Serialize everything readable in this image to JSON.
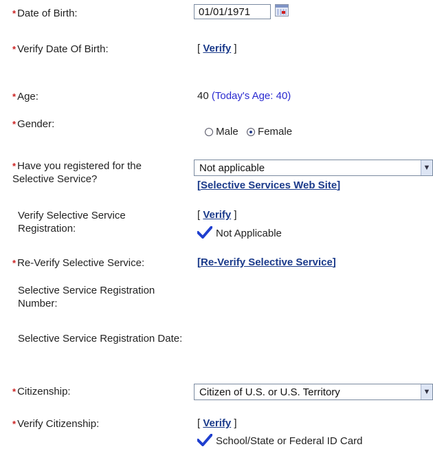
{
  "fields": {
    "dob": {
      "label": "Date of Birth:",
      "value": "01/01/1971"
    },
    "verify_dob": {
      "label": "Verify Date Of Birth:",
      "link": "Verify"
    },
    "age": {
      "label": "Age:",
      "value": "40",
      "todays": "(Today's Age: 40)"
    },
    "gender": {
      "label": "Gender:",
      "option_male": "Male",
      "option_female": "Female",
      "selected": "Female"
    },
    "selective_service": {
      "label": "Have you registered for the Selective Service?",
      "selected": "Not applicable",
      "link": "Selective Services Web Site"
    },
    "verify_selective": {
      "label": "Verify Selective Service Registration:",
      "link": "Verify",
      "status": "Not Applicable"
    },
    "reverify_selective": {
      "label": "Re-Verify Selective Service:",
      "link": "Re-Verify Selective Service"
    },
    "ss_reg_number": {
      "label": "Selective Service Registration Number:"
    },
    "ss_reg_date": {
      "label": "Selective Service Registration Date:"
    },
    "citizenship": {
      "label": "Citizenship:",
      "selected": "Citizen of U.S. or U.S. Territory"
    },
    "verify_citizenship": {
      "label": "Verify Citizenship:",
      "link": "Verify",
      "status": "School/State or Federal ID Card"
    }
  },
  "required_marker": "*",
  "colors": {
    "link": "#1a3a8a",
    "required": "#cc2222",
    "age_note": "#2a2ad0",
    "check": "#1f3fcf"
  },
  "icons": {
    "calendar": "calendar-icon",
    "check": "checkmark-icon",
    "dropdown": "chevron-down-icon"
  }
}
